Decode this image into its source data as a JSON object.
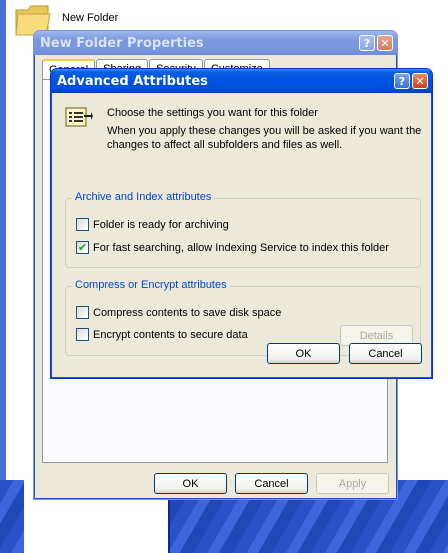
{
  "desktop": {
    "folder_label": "New Folder"
  },
  "properties_window": {
    "title": "New Folder Properties",
    "tabs": [
      "General",
      "Sharing",
      "Security",
      "Customize"
    ],
    "buttons": {
      "ok": "OK",
      "cancel": "Cancel",
      "apply": "Apply"
    }
  },
  "advanced_dialog": {
    "title": "Advanced Attributes",
    "intro_line": "Choose the settings you want for this folder",
    "intro_detail": "When you apply these changes you will be asked if you want the changes to affect all subfolders and files as well.",
    "archive_group": {
      "title": "Archive and Index attributes",
      "options": [
        {
          "label": "Folder is ready for archiving",
          "checked": false
        },
        {
          "label": "For fast searching, allow Indexing Service to index this folder",
          "checked": true
        }
      ]
    },
    "compress_group": {
      "title": "Compress or Encrypt attributes",
      "options": [
        {
          "label": "Compress contents to save disk space",
          "checked": false
        },
        {
          "label": "Encrypt contents to secure data",
          "checked": false
        }
      ],
      "details_label": "Details"
    },
    "buttons": {
      "ok": "OK",
      "cancel": "Cancel"
    }
  },
  "titlebar_buttons": {
    "help": "?",
    "close": "✕"
  },
  "check_mark": "✔",
  "colors": {
    "accent_title": "#0054e3",
    "group_title": "#0046d5",
    "window_bg": "#ece9d8"
  }
}
